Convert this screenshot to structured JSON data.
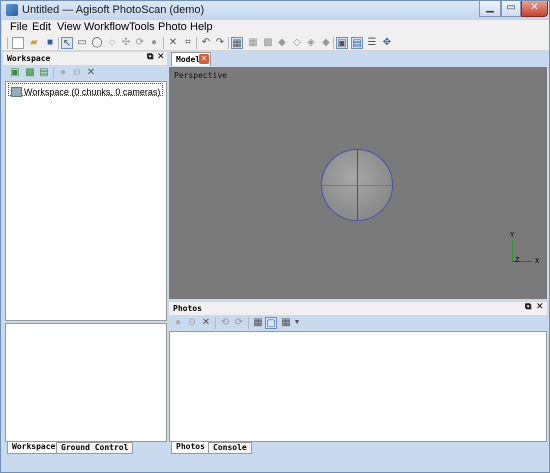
{
  "window": {
    "title": "Untitled — Agisoft PhotoScan (demo)"
  },
  "menu": [
    "File",
    "Edit",
    "View",
    "Workflow",
    "Tools",
    "Photo",
    "Help"
  ],
  "workspace_panel": {
    "title": "Workspace",
    "tree_item": "Workspace (0 chunks, 0 cameras)",
    "tabs": [
      "Workspace",
      "Ground Control"
    ]
  },
  "model_view": {
    "tab_label": "Model",
    "viewport_label": "Perspective",
    "axes": {
      "y": "Y",
      "z": "Z",
      "x": "X"
    },
    "colors": {
      "background": "#7a7a7a",
      "x_axis": "#c42222",
      "y_axis": "#2a9a2a",
      "z_axis": "#2a2ab0"
    }
  },
  "photos_panel": {
    "title": "Photos",
    "tabs": [
      "Photos",
      "Console"
    ]
  },
  "icons": {
    "toolbar": [
      "new-icon",
      "open-icon",
      "save-icon",
      "select-icon",
      "rectangle-select-icon",
      "ellipse-select-icon",
      "free-select-icon",
      "navigation-icon",
      "rotate-icon",
      "resize-icon",
      "delete-icon",
      "crop-icon",
      "undo-icon",
      "redo-icon",
      "region-icon",
      "grid-icon",
      "point-cloud-icon",
      "solid-icon",
      "wireframe-icon",
      "shaded-icon",
      "textured-icon",
      "cameras-icon",
      "thumbnails-icon",
      "list-icon",
      "center-icon"
    ]
  }
}
